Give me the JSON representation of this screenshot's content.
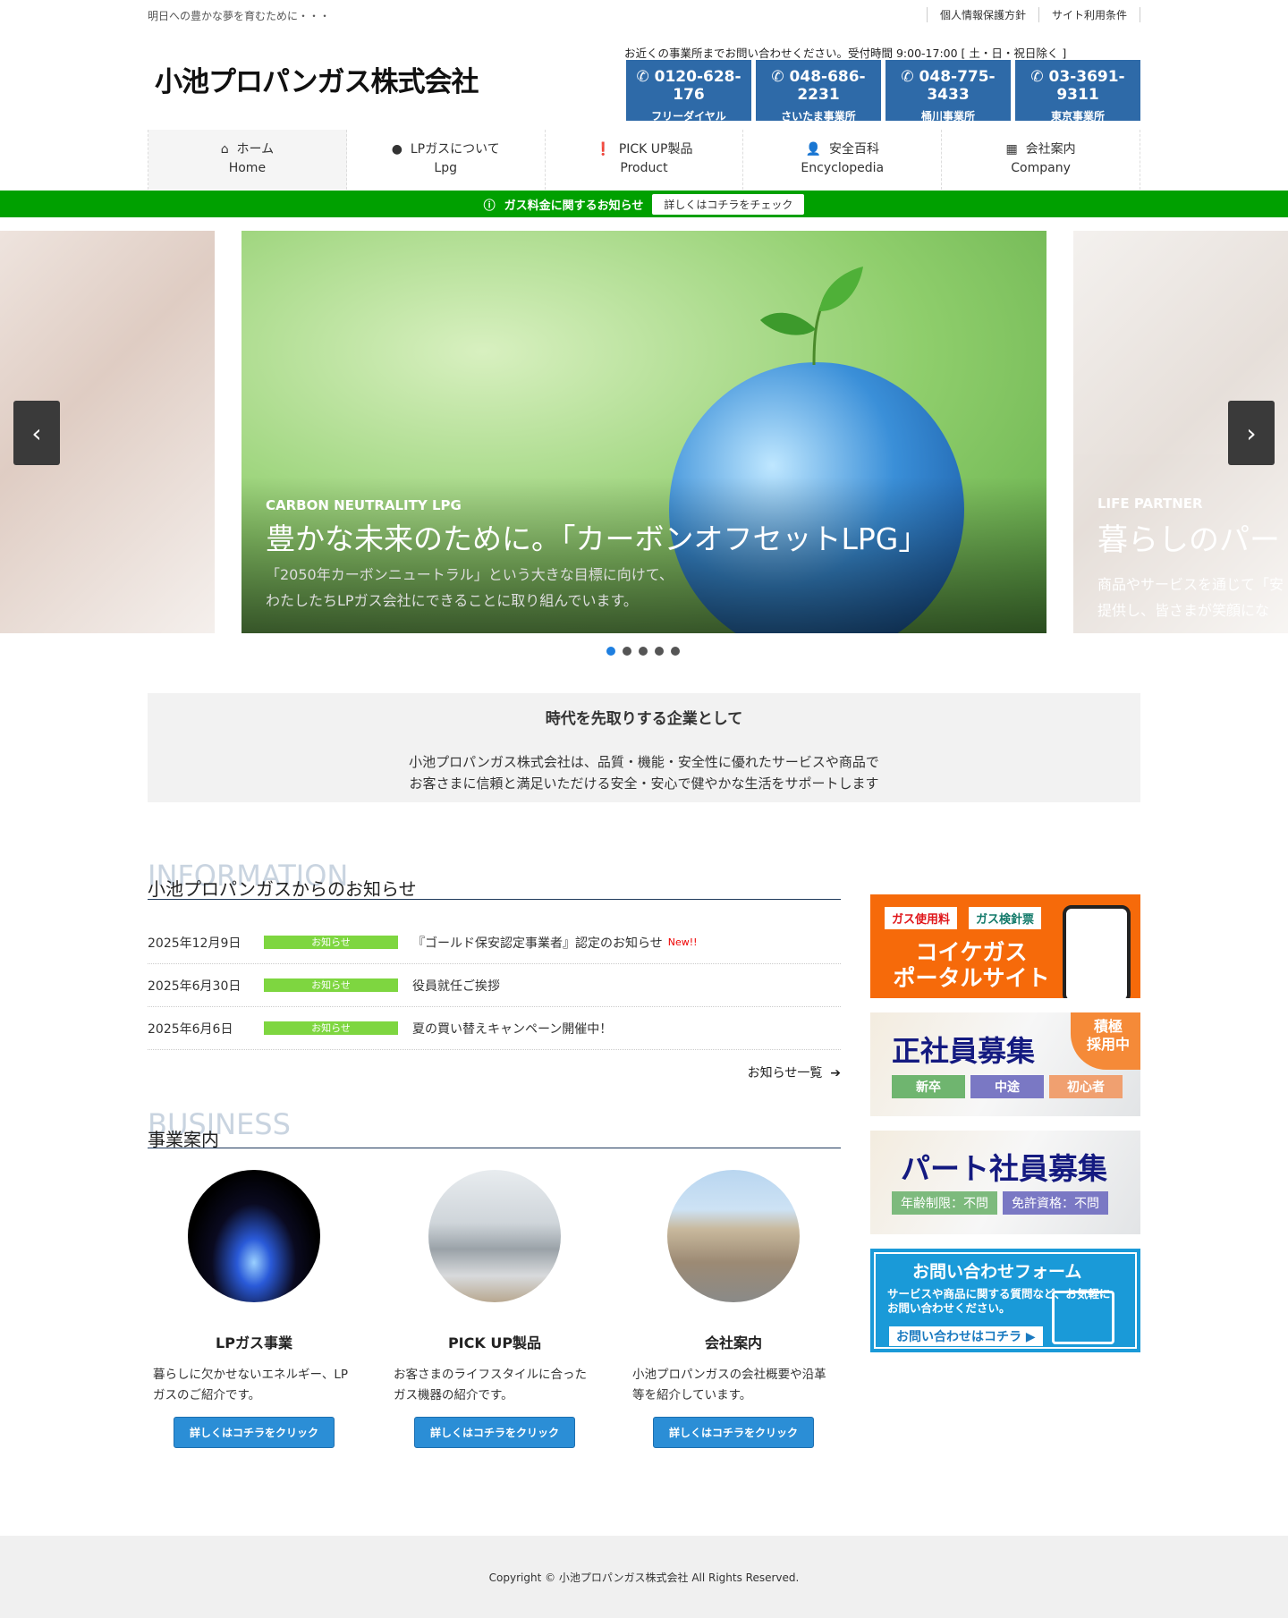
{
  "header": {
    "tagline": "明日への豊かな夢を育むために・・・",
    "links": [
      "個人情報保護方針",
      "サイト利用条件"
    ],
    "logo": "小池プロパンガス株式会社",
    "contact_note": "お近くの事業所までお問い合わせください。受付時間 9:00-17:00 [ 土・日・祝日除く ]",
    "phones": [
      {
        "number": "0120-628-176",
        "label": "フリーダイヤル"
      },
      {
        "number": "048-686-2231",
        "label": "さいたま事業所"
      },
      {
        "number": "048-775-3433",
        "label": "桶川事業所"
      },
      {
        "number": "03-3691-9311",
        "label": "東京事業所"
      }
    ]
  },
  "nav": [
    {
      "jp": "ホーム",
      "en": "Home",
      "icon": "home-icon"
    },
    {
      "jp": "LPガスについて",
      "en": "Lpg",
      "icon": "flame-icon"
    },
    {
      "jp": "PICK UP製品",
      "en": "Product",
      "icon": "alert-icon"
    },
    {
      "jp": "安全百科",
      "en": "Encyclopedia",
      "icon": "user-shield-icon"
    },
    {
      "jp": "会社案内",
      "en": "Company",
      "icon": "building-icon"
    }
  ],
  "notice": {
    "text": "ガス料金に関するお知らせ",
    "button": "詳しくはコチラをチェック"
  },
  "slider": {
    "main": {
      "kicker": "CARBON NEUTRALITY LPG",
      "title": "豊かな未来のために。「カーボンオフセットLPG」",
      "desc1": "「2050年カーボンニュートラル」という大きな目標に向けて、",
      "desc2": "わたしたちLPガス会社にできることに取り組んでいます。"
    },
    "next": {
      "kicker": "LIFE PARTNER",
      "title": "暮らしのパー",
      "desc1": "商品やサービスを通じて「安",
      "desc2": "提供し、皆さまが笑顔にな"
    },
    "prev": "‹",
    "nextArrow": "›",
    "active_index": 0,
    "count": 5
  },
  "intro": {
    "title": "時代を先取りする企業として",
    "line1": "小池プロパンガス株式会社は、品質・機能・安全性に優れたサービスや商品で",
    "line2": "お客さまに信頼と満足いただける安全・安心で健やかな生活をサポートします"
  },
  "info": {
    "en": "INFORMATION",
    "jp": "小池プロパンガスからのお知らせ",
    "more": "お知らせ一覧",
    "items": [
      {
        "date": "2025年12月9日",
        "badge": "お知らせ",
        "title": "『ゴールド保安認定事業者』認定のお知らせ",
        "new": "New!!"
      },
      {
        "date": "2025年6月30日",
        "badge": "お知らせ",
        "title": "役員就任ご挨拶"
      },
      {
        "date": "2025年6月6日",
        "badge": "お知らせ",
        "title": "夏の買い替えキャンペーン開催中！"
      }
    ]
  },
  "business": {
    "en": "BUSINESS",
    "jp": "事業案内",
    "items": [
      {
        "title": "LPガス事業",
        "desc": "暮らしに欠かせないエネルギー、LPガスのご紹介です。",
        "button": "詳しくはコチラをクリック"
      },
      {
        "title": "PICK UP製品",
        "desc": "お客さまのライフスタイルに合ったガス機器の紹介です。",
        "button": "詳しくはコチラをクリック"
      },
      {
        "title": "会社案内",
        "desc": "小池プロパンガスの会社概要や沿革等を紹介しています。",
        "button": "詳しくはコチラをクリック"
      }
    ]
  },
  "banners": {
    "portal": {
      "tag1": "ガス使用料",
      "tag2": "ガス検針票",
      "title1": "コイケガス",
      "title2": "ポータルサイト"
    },
    "fulltime": {
      "title": "正社員募集",
      "badge1": "積極",
      "badge2": "採用中",
      "tags": [
        "新卒",
        "中途",
        "初心者"
      ]
    },
    "parttime": {
      "title": "パート社員募集",
      "tags": [
        "年齢制限：不問",
        "免許資格：不問"
      ]
    },
    "contact": {
      "title": "お問い合わせフォーム",
      "desc1": "サービスや商品に関する質問など、お気軽に",
      "desc2": "お問い合わせください。",
      "button": "お問い合わせはコチラ"
    }
  },
  "footer": {
    "copyright": "Copyright © 小池プロパンガス株式会社 All Rights Reserved."
  }
}
